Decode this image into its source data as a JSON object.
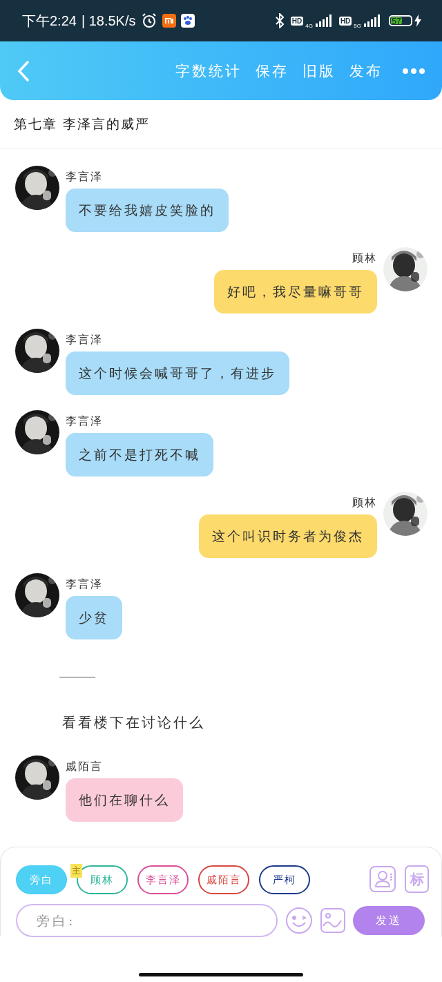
{
  "status_bar": {
    "time": "下午2:24",
    "speed": "| 18.5K/s",
    "networks": [
      {
        "badge": "HD",
        "gen": "4G"
      },
      {
        "badge": "HD",
        "gen": "5G"
      }
    ],
    "battery": "57"
  },
  "header": {
    "actions": [
      "字数统计",
      "保存",
      "旧版",
      "发布"
    ]
  },
  "chapter_title": "第七章 李泽言的威严",
  "messages": [
    {
      "kind": "left",
      "name": "李言泽",
      "text": "不要给我嬉皮笑脸的",
      "color": "#a8dcf8"
    },
    {
      "kind": "right",
      "name": "顾林",
      "text": "好吧，我尽量嘛哥哥",
      "color": "#fcda6c"
    },
    {
      "kind": "left",
      "name": "李言泽",
      "text": "这个时候会喊哥哥了，有进步",
      "color": "#a8dcf8"
    },
    {
      "kind": "left",
      "name": "李言泽",
      "text": "之前不是打死不喊",
      "color": "#a8dcf8"
    },
    {
      "kind": "right",
      "name": "顾林",
      "text": "这个叫识时务者为俊杰",
      "color": "#fcda6c"
    },
    {
      "kind": "left",
      "name": "李言泽",
      "text": "少贫",
      "color": "#a8dcf8"
    },
    {
      "kind": "rule"
    },
    {
      "kind": "narration",
      "text": "看看楼下在讨论什么"
    },
    {
      "kind": "left",
      "name": "戚陌言",
      "text": "他们在聊什么",
      "color": "#fccbd9"
    }
  ],
  "compose": {
    "roles": [
      {
        "label": "旁白",
        "color": "#4fd0f5",
        "selected": true
      },
      {
        "label": "顾林",
        "color": "#2fb59a",
        "selected": false,
        "main_badge": "主"
      },
      {
        "label": "李言泽",
        "color": "#dc4f98",
        "selected": false
      },
      {
        "label": "戚陌言",
        "color": "#d9473f",
        "selected": false
      },
      {
        "label": "严柯",
        "color": "#1d3a8a",
        "selected": false
      }
    ],
    "tag_button": "标",
    "input": {
      "placeholder": "旁白:"
    },
    "send": "发送"
  }
}
